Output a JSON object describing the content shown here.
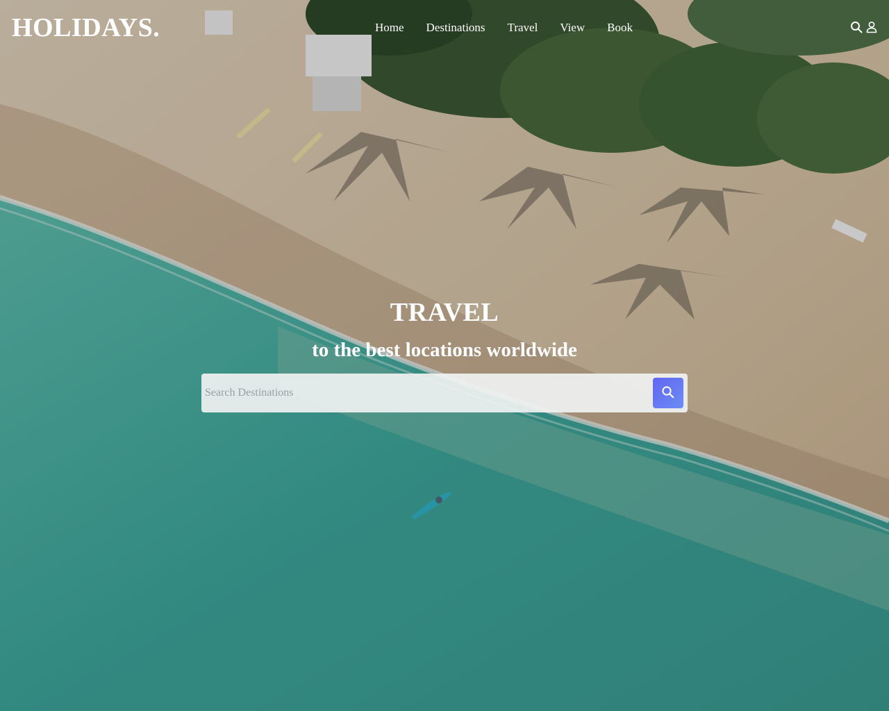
{
  "brand": {
    "logo_text": "HOLIDAYS."
  },
  "nav": {
    "items": [
      {
        "label": "Home"
      },
      {
        "label": "Destinations"
      },
      {
        "label": "Travel"
      },
      {
        "label": "View"
      },
      {
        "label": "Book"
      }
    ],
    "icons": [
      "search-icon",
      "user-icon"
    ]
  },
  "hero": {
    "title": "TRAVEL",
    "subtitle": "to the best locations worldwide",
    "background": "aerial-beach-with-palm-trees-and-surfer"
  },
  "search": {
    "placeholder": "Search Destinations",
    "value": "",
    "button_icon": "search-icon"
  },
  "colors": {
    "text": "#ffffff",
    "search_button_start": "#6366f1",
    "search_button_end": "#6b8cf5",
    "search_box": "#f0f2f2",
    "sea": "#3aa59c",
    "sand": "#d9c4a8"
  }
}
